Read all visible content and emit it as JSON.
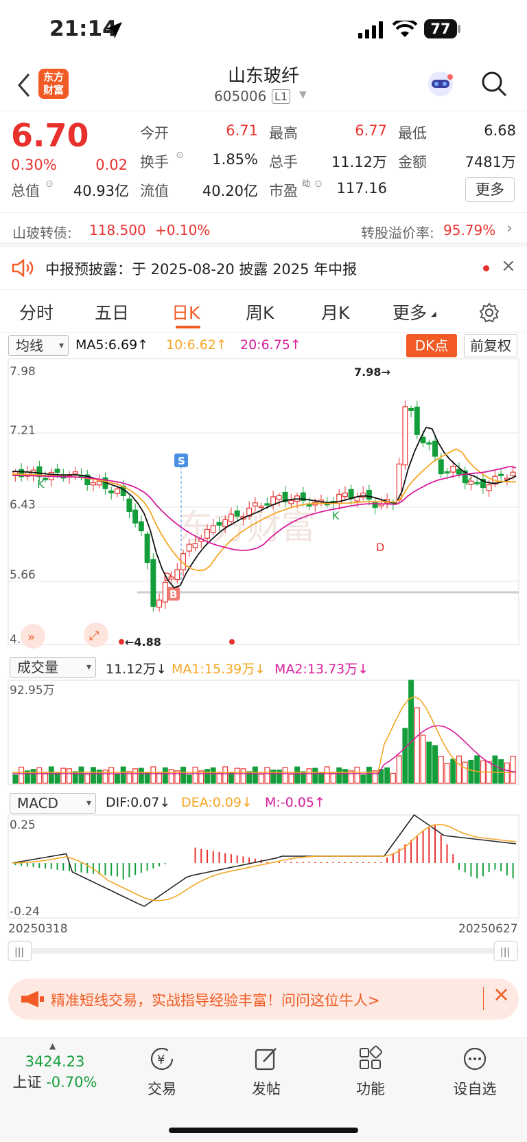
{
  "status": {
    "time": "21:14",
    "battery": "77"
  },
  "header": {
    "title": "山东玻纤",
    "code": "605006",
    "level": "L1",
    "logo_line1": "东方",
    "logo_line2": "财富"
  },
  "quote": {
    "price": "6.70",
    "change_pct": "0.30%",
    "change": "0.02",
    "fields": [
      {
        "label": "今开",
        "value": "6.71",
        "color": "red"
      },
      {
        "label": "最高",
        "value": "6.77",
        "color": "red"
      },
      {
        "label": "最低",
        "value": "6.68",
        "color": "dark"
      },
      {
        "label": "换手",
        "value": "1.85%",
        "color": "dark"
      },
      {
        "label": "总手",
        "value": "11.12万",
        "color": "dark"
      },
      {
        "label": "金额",
        "value": "7481万",
        "color": "dark"
      },
      {
        "label": "总值",
        "value": "40.93亿",
        "color": "dark"
      },
      {
        "label": "流值",
        "value": "40.20亿",
        "color": "dark"
      },
      {
        "label": "市盈",
        "value": "117.16",
        "color": "dark"
      }
    ],
    "pe_sup": "动",
    "more_label": "更多"
  },
  "bond": {
    "name": "山玻转债:",
    "price": "118.500",
    "change": "+0.10%",
    "premium_label": "转股溢价率:",
    "premium": "95.79%"
  },
  "notice": {
    "text": "中报预披露：于 2025-08-20 披露 2025 年中报"
  },
  "tabs": [
    "分时",
    "五日",
    "日K",
    "周K",
    "月K",
    "更多"
  ],
  "active_tab": "日K",
  "kline": {
    "indicator": "均线",
    "ma5": "MA5:6.69↑",
    "ma10": "10:6.62↑",
    "ma20": "20:6.75↑",
    "dk_label": "DK点",
    "adjust_label": "前复权",
    "ymax": "7.98",
    "y2": "7.21",
    "y3": "6.43",
    "y4": "5.66",
    "ymin": "4.88",
    "high_note": "7.98→",
    "low_note": "←4.88",
    "markers": [
      "S",
      "B",
      "D",
      "D",
      "K",
      "K",
      "K"
    ],
    "watermark": "东方财富"
  },
  "volume": {
    "indicator": "成交量",
    "vol": "11.12万↓",
    "ma1": "MA1:15.39万↓",
    "ma2": "MA2:13.73万↓",
    "ymax": "92.95万"
  },
  "macd": {
    "indicator": "MACD",
    "dif": "DIF:0.07↓",
    "dea": "DEA:0.09↓",
    "m": "M:-0.05↑",
    "ymax": "0.25",
    "ymin": "-0.24",
    "start_date": "20250318",
    "end_date": "20250627"
  },
  "banner": {
    "text": "精准短线交易，实战指导经验丰富！问问这位牛人>"
  },
  "nav": {
    "index_value": "3424.23",
    "index_name": "上证",
    "index_change": "-0.70%",
    "items": [
      "交易",
      "发帖",
      "功能",
      "设自选"
    ]
  },
  "colors": {
    "up": "#e8312d",
    "down": "#149e3b",
    "ma5": "#111111",
    "ma10": "#f5a623",
    "ma20": "#d81b9c"
  }
}
